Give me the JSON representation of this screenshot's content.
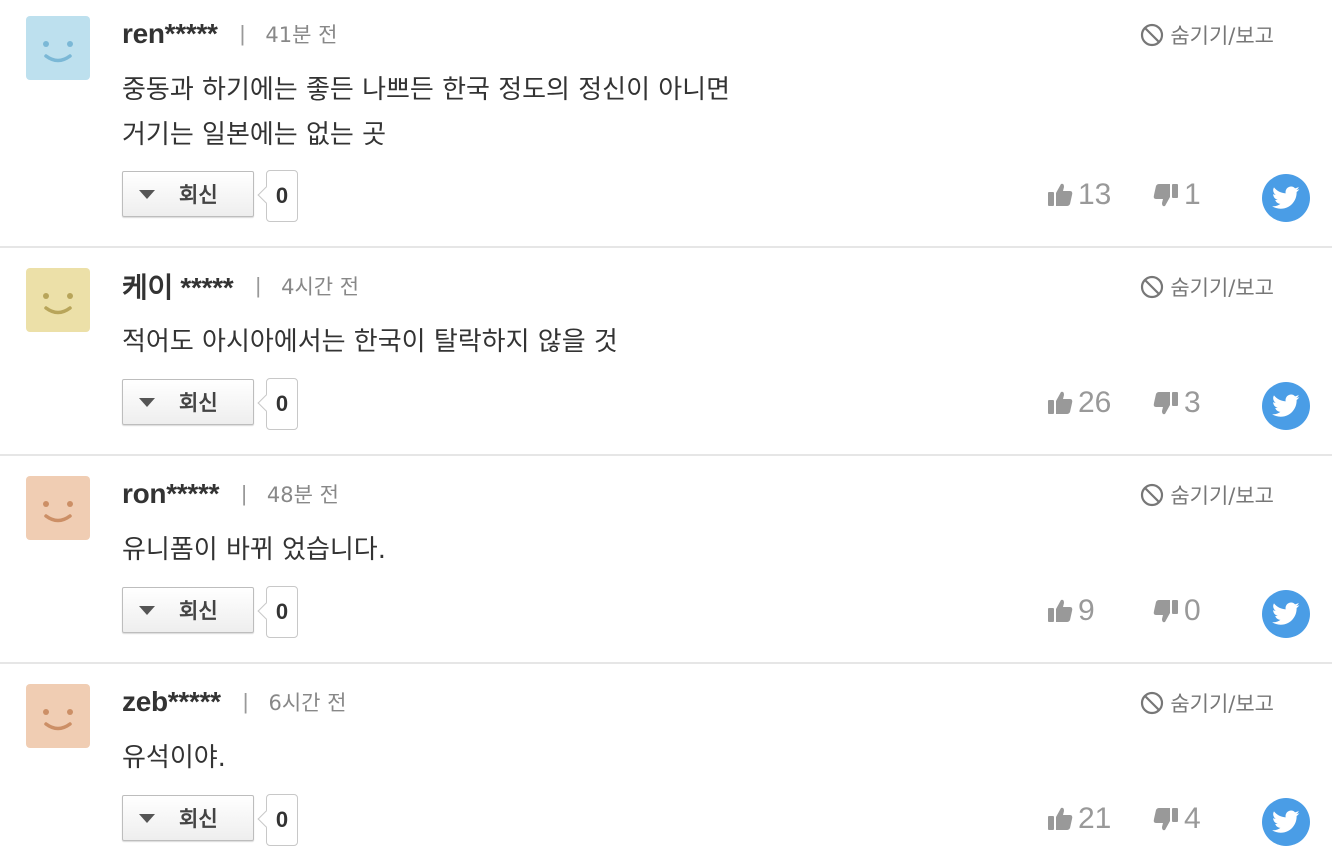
{
  "labels": {
    "hide_report": "숨기기/보고",
    "reply": "회신",
    "separator": "|"
  },
  "comments": [
    {
      "user": "ren*****",
      "time": "41분 전",
      "avatar_color": "#bde0ee",
      "face_color": "#7bb8d6",
      "lines": [
        "중동과 하기에는 좋든 나쁘든 한국 정도의 정신이 아니면",
        "거기는 일본에는 없는 곳"
      ],
      "reply_count": "0",
      "likes": "13",
      "dislikes": "1"
    },
    {
      "user": "케이 *****",
      "time": "4시간 전",
      "avatar_color": "#ece0a8",
      "face_color": "#b8a55a",
      "lines": [
        "적어도 아시아에서는 한국이 탈락하지 않을 것"
      ],
      "reply_count": "0",
      "likes": "26",
      "dislikes": "3"
    },
    {
      "user": "ron*****",
      "time": "48분 전",
      "avatar_color": "#f0cdb3",
      "face_color": "#cc8f66",
      "lines": [
        "유니폼이 바뀌 었습니다."
      ],
      "reply_count": "0",
      "likes": "9",
      "dislikes": "0"
    },
    {
      "user": "zeb*****",
      "time": "6시간 전",
      "avatar_color": "#f0cdb3",
      "face_color": "#cc8f66",
      "lines": [
        "유석이야."
      ],
      "reply_count": "0",
      "likes": "21",
      "dislikes": "4"
    }
  ],
  "colors": {
    "twitter": "#4a9de6",
    "vote_gray": "#999999"
  }
}
